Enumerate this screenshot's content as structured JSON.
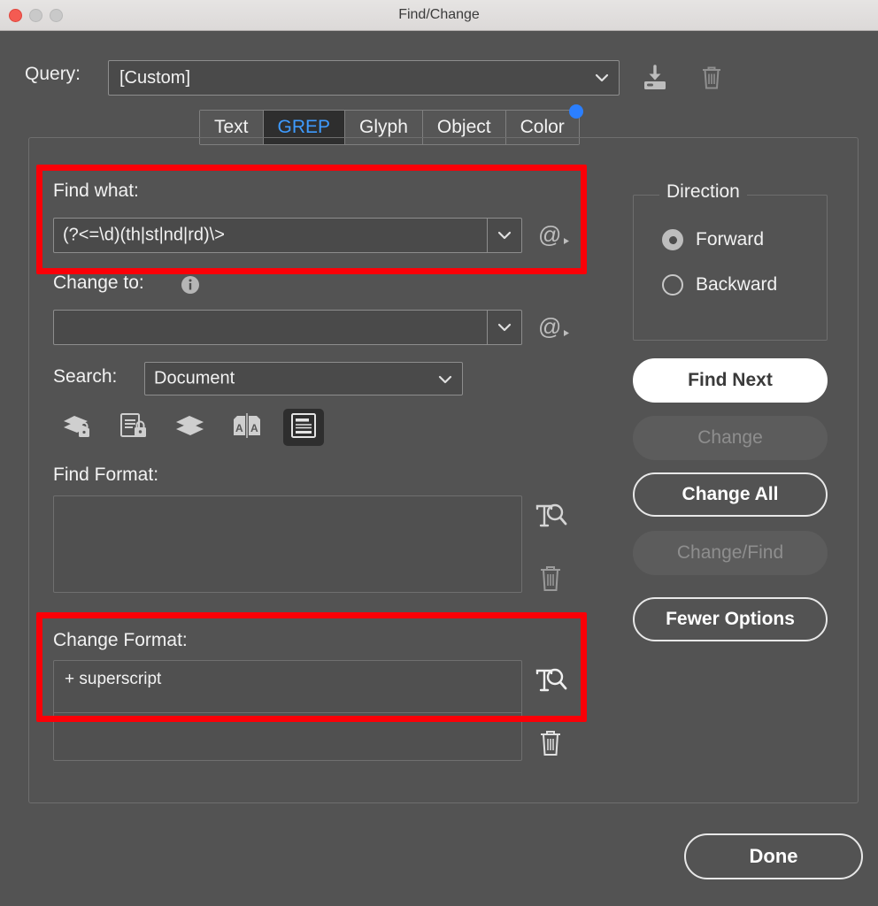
{
  "window": {
    "title": "Find/Change",
    "traffic_lights": [
      "close-button",
      "minimize-button",
      "zoom-button"
    ]
  },
  "query": {
    "label": "Query:",
    "value": "[Custom]",
    "placeholder": "[Custom]",
    "save_icon": "save-query-icon",
    "delete_icon": "delete-query-icon",
    "dropdown_icon": "chevron-down-icon"
  },
  "tabs": [
    {
      "label": "Text",
      "active": false
    },
    {
      "label": "GREP",
      "active": true
    },
    {
      "label": "Glyph",
      "active": false
    },
    {
      "label": "Object",
      "active": false
    },
    {
      "label": "Color",
      "active": false,
      "badge": true
    }
  ],
  "find": {
    "label": "Find what:",
    "value": "(?<=\\d)(th|st|nd|rd)\\>",
    "special_chars_icon": "at-menu-icon"
  },
  "change": {
    "label": "Change to:",
    "value": "",
    "info_icon": "info-icon",
    "special_chars_icon": "at-menu-icon"
  },
  "search": {
    "label": "Search:",
    "value": "Document",
    "options": [
      "Document"
    ]
  },
  "options": [
    {
      "name": "include-locked-layers",
      "label": "Include Locked Layers",
      "icon": "locked-layers-icon",
      "active": false
    },
    {
      "name": "include-locked-stories",
      "label": "Include Locked Stories",
      "icon": "locked-story-icon",
      "active": false
    },
    {
      "name": "include-hidden-layers",
      "label": "Include Hidden Layers",
      "icon": "hidden-layers-icon",
      "active": false
    },
    {
      "name": "include-master-pages",
      "label": "Include Master Pages",
      "icon": "master-pages-icon",
      "active": false
    },
    {
      "name": "include-footnotes",
      "label": "Include Footnotes",
      "icon": "footnotes-icon",
      "active": true
    }
  ],
  "find_format": {
    "label": "Find Format:",
    "value": "",
    "specify_icon": "specify-attributes-icon",
    "clear_icon": "clear-format-icon"
  },
  "change_format": {
    "label": "Change Format:",
    "value": "+ superscript",
    "specify_icon": "specify-attributes-icon",
    "clear_icon": "clear-format-icon"
  },
  "direction": {
    "title": "Direction",
    "options": [
      {
        "label": "Forward",
        "selected": true
      },
      {
        "label": "Backward",
        "selected": false
      }
    ]
  },
  "buttons": {
    "find_next": {
      "label": "Find Next",
      "state": "default"
    },
    "change": {
      "label": "Change",
      "state": "disabled"
    },
    "change_all": {
      "label": "Change All",
      "state": "enabled"
    },
    "change_find": {
      "label": "Change/Find",
      "state": "disabled"
    },
    "fewer": {
      "label": "Fewer Options",
      "state": "enabled"
    },
    "done": {
      "label": "Done",
      "state": "enabled"
    }
  },
  "annotations": [
    {
      "name": "find-what-highlight",
      "color": "#fb0007"
    },
    {
      "name": "change-format-highlight",
      "color": "#fb0007"
    }
  ],
  "colors": {
    "window_bg": "#535353",
    "titlebar": "#e2dfde",
    "field_bg": "#4a4a4a",
    "tab_active_bg": "#2e2e2e",
    "tab_active_text": "#3e9bff",
    "badge": "#2b7fff",
    "annotation": "#fb0007",
    "close_button": "#f45b52"
  }
}
